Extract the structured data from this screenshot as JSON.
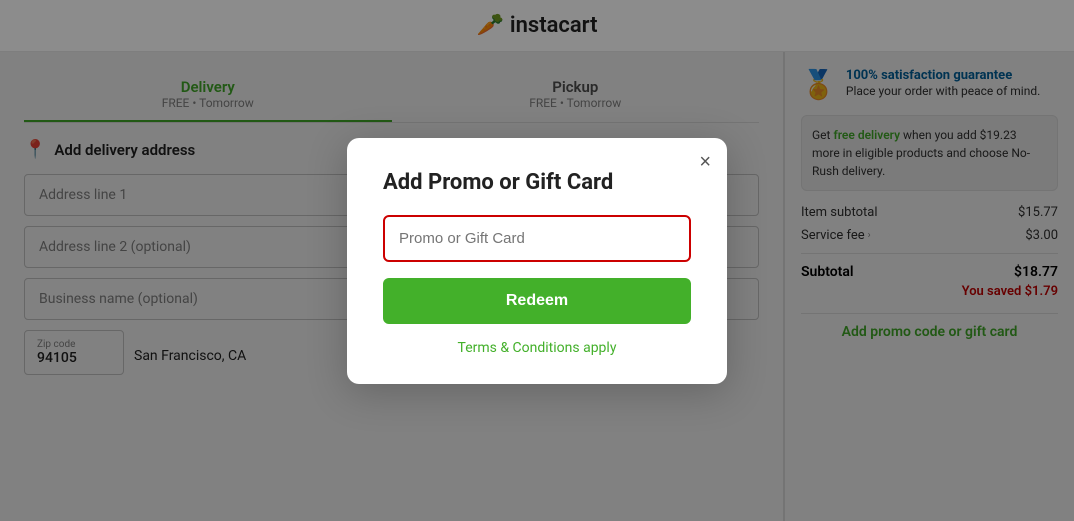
{
  "header": {
    "logo_text": "instacart",
    "logo_icon": "🥕"
  },
  "tabs": {
    "delivery": {
      "label": "Delivery",
      "sub": "FREE • Tomorrow"
    },
    "pickup": {
      "label": "Pickup",
      "sub": "FREE • Tomorrow"
    }
  },
  "address_form": {
    "header": "Add delivery address",
    "field1_placeholder": "Address line 1",
    "field2_placeholder": "Address line 2 (optional)",
    "field3_placeholder": "Business name (optional)",
    "zip_label": "Zip code",
    "zip_value": "94105",
    "city_value": "San Francisco, CA"
  },
  "right_panel": {
    "guarantee_title": "100% satisfaction guarantee",
    "guarantee_body": "Place your order with peace of mind.",
    "guarantee_info_icon": "ℹ",
    "free_delivery_text": "Get ",
    "free_delivery_link": "free delivery",
    "free_delivery_rest": " when you add $19.23 more in eligible products and choose No-Rush delivery.",
    "item_subtotal_label": "Item subtotal",
    "item_subtotal_value": "$15.77",
    "service_fee_label": "Service fee",
    "service_fee_value": "$3.00",
    "subtotal_label": "Subtotal",
    "subtotal_value": "$18.77",
    "savings_text": "You saved $1.79",
    "add_promo_label": "Add promo code or gift card"
  },
  "modal": {
    "title": "Add Promo or Gift Card",
    "input_placeholder": "Promo or Gift Card",
    "redeem_label": "Redeem",
    "terms_label": "Terms & Conditions apply",
    "close_label": "×"
  }
}
